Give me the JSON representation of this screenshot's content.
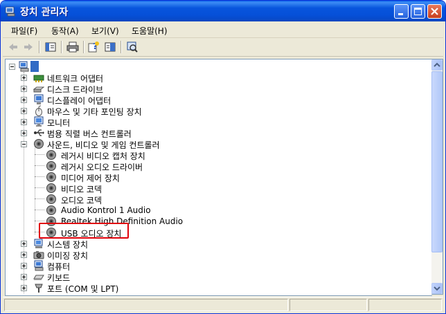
{
  "window": {
    "title": "장치 관리자"
  },
  "menu": [
    {
      "label": "파일(F)"
    },
    {
      "label": "동작(A)"
    },
    {
      "label": "보기(V)"
    },
    {
      "label": "도움말(H)"
    }
  ],
  "tree": {
    "categories": [
      {
        "label": "네트워크 어댑터",
        "icon": "network-adapter-icon",
        "expanded": false
      },
      {
        "label": "디스크 드라이브",
        "icon": "disk-drive-icon",
        "expanded": false
      },
      {
        "label": "디스플레이 어댑터",
        "icon": "display-adapter-icon",
        "expanded": false
      },
      {
        "label": "마우스 및 기타 포인팅 장치",
        "icon": "mouse-icon",
        "expanded": false
      },
      {
        "label": "모니터",
        "icon": "monitor-icon",
        "expanded": false
      },
      {
        "label": "범용 직렬 버스 컨트롤러",
        "icon": "usb-icon",
        "expanded": false
      },
      {
        "label": "사운드, 비디오 및 게임 컨트롤러",
        "icon": "sound-icon",
        "expanded": true,
        "children": [
          {
            "label": "레거시 비디오 캡처 장치"
          },
          {
            "label": "레거시 오디오 드라이버"
          },
          {
            "label": "미디어 제어 장치"
          },
          {
            "label": "비디오 코덱"
          },
          {
            "label": "오디오 코덱"
          },
          {
            "label": "Audio Kontrol 1 Audio"
          },
          {
            "label": "Realtek High Definition Audio"
          },
          {
            "label": "USB 오디오 장치",
            "highlighted": true
          }
        ]
      },
      {
        "label": "시스템 장치",
        "icon": "system-device-icon",
        "expanded": false
      },
      {
        "label": "이미징 장치",
        "icon": "imaging-device-icon",
        "expanded": false
      },
      {
        "label": "컴퓨터",
        "icon": "computer-icon",
        "expanded": false
      },
      {
        "label": "키보드",
        "icon": "keyboard-icon",
        "expanded": false
      },
      {
        "label": "포트 (COM 및 LPT)",
        "icon": "port-icon",
        "expanded": false
      }
    ]
  },
  "colors": {
    "titlebar": "#0855DD",
    "highlight": "#E0000A",
    "window_bg": "#ECE9D8"
  }
}
